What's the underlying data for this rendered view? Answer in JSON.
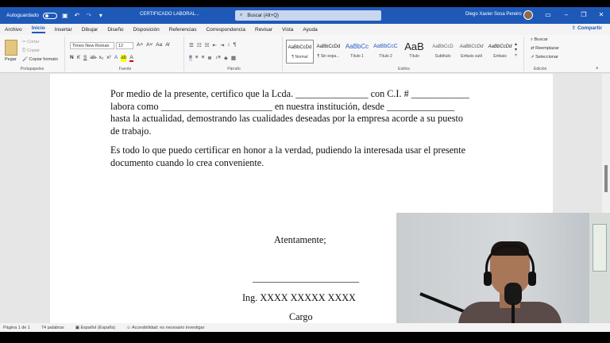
{
  "titlebar": {
    "autosave_label": "Autoguardado",
    "doc_title": "CERTIFICADO LABORAL...",
    "search_placeholder": "Buscar (Alt+Q)",
    "user_name": "Diego Xavier Sosa Pereiro"
  },
  "menu": {
    "items": [
      "Archivo",
      "Inicio",
      "Insertar",
      "Dibujar",
      "Diseño",
      "Disposición",
      "Referencias",
      "Correspondencia",
      "Revisar",
      "Vista",
      "Ayuda"
    ],
    "share": "Compartir"
  },
  "ribbon": {
    "clipboard": {
      "paste": "Pegar",
      "cut": "Cortar",
      "copy": "Copiar",
      "format_painter": "Copiar formato",
      "label": "Portapapeles"
    },
    "font": {
      "family": "Times New Roman",
      "size": "12",
      "label": "Fuente"
    },
    "paragraph": {
      "label": "Párrafo"
    },
    "styles": {
      "label": "Estilos",
      "items": [
        {
          "sample": "AaBbCcDd",
          "name": "¶ Normal"
        },
        {
          "sample": "AaBbCcDd",
          "name": "¶ Sin espa..."
        },
        {
          "sample": "AaBbCc",
          "name": "Título 1"
        },
        {
          "sample": "AaBbCcC",
          "name": "Título 2"
        },
        {
          "sample": "AaB",
          "name": "Título"
        },
        {
          "sample": "AaBbCcD",
          "name": "Subtítulo"
        },
        {
          "sample": "AaBbCcDd",
          "name": "Énfasis sutil"
        },
        {
          "sample": "AaBbCcDd",
          "name": "Énfasis"
        }
      ]
    },
    "editing": {
      "find": "Buscar",
      "replace": "Reemplazar",
      "select": "Seleccionar",
      "label": "Edición"
    }
  },
  "document": {
    "p1": [
      "Por medio de la presente, certifico que la Lcda. _______________ con C.I. # ____________",
      "labora como _______________________ en nuestra institución, desde ______________",
      "hasta la actualidad, demostrando las cualidades deseadas por la empresa acorde a su puesto",
      "de trabajo."
    ],
    "p2": [
      "Es todo lo que puedo certificar en honor a la verdad, pudiendo la interesada usar el presente",
      "documento cuando lo crea conveniente."
    ],
    "closing": "Atentamente;",
    "signature_line": "______________________",
    "signer": "Ing. XXXX XXXXX XXXX",
    "position": "Cargo"
  },
  "status": {
    "page": "Página 1 de 1",
    "words": "74 palabras",
    "language": "Español (España)",
    "accessibility": "Accesibilidad: es necesario investigar"
  }
}
